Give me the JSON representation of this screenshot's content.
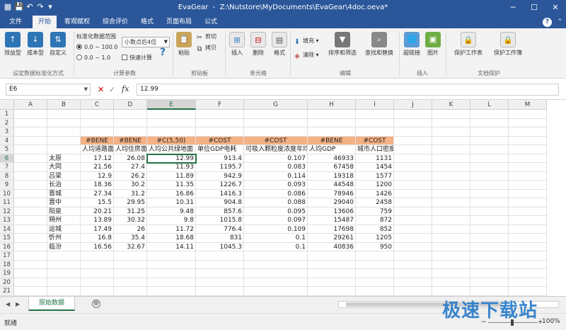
{
  "window": {
    "title": "EvaGear  -  Z:\\Nutstore\\MyDocuments\\EvaGear\\4doc.oeva*",
    "minimize": "─",
    "maximize": "☐",
    "close": "✕"
  },
  "tabs": [
    {
      "label": "文件"
    },
    {
      "label": "开始"
    },
    {
      "label": "客观赋权"
    },
    {
      "label": "综合评价"
    },
    {
      "label": "格式"
    },
    {
      "label": "页面布局"
    },
    {
      "label": "公式"
    }
  ],
  "ribbon": {
    "standardize": {
      "buttons": [
        {
          "label": "效益型",
          "icon": "benefit-type-icon"
        },
        {
          "label": "成本型",
          "icon": "cost-type-icon"
        },
        {
          "label": "自定义",
          "icon": "custom-type-icon"
        }
      ],
      "group_label": "设定数据标准化方式"
    },
    "calc": {
      "range_label": "标准化数据范围",
      "option1": "0.0 ~ 100.0",
      "option2": "0.0 ~ 1.0",
      "decimal_value": "小数点后4位",
      "quick_calc": "快速计算",
      "group_label": "计算参数"
    },
    "clipboard": {
      "paste": "粘贴",
      "cut": "剪切",
      "copy": "拷贝",
      "group_label": "剪贴板"
    },
    "cells": {
      "insert": "插入",
      "delete": "删除",
      "format": "格式",
      "group_label": "单元格"
    },
    "edit": {
      "fill": "填充",
      "clear": "清除",
      "sort_filter": "排序和筛选",
      "find_replace": "查找和替换",
      "group_label": "编辑"
    },
    "insert": {
      "hyperlink": "超链接",
      "picture": "图片",
      "group_label": "插入"
    },
    "protect": {
      "sheet": "保护工作表",
      "book": "保护工作簿",
      "group_label": "文档保护"
    }
  },
  "formula_bar": {
    "name_box": "E6",
    "value": "12.99"
  },
  "columns": [
    "A",
    "B",
    "C",
    "D",
    "E",
    "F",
    "G",
    "H",
    "I",
    "J",
    "K",
    "L",
    "M"
  ],
  "rows": [
    "1",
    "2",
    "3",
    "4",
    "5",
    "6",
    "7",
    "8",
    "9",
    "10",
    "11",
    "12",
    "13",
    "14",
    "15",
    "16",
    "17",
    "18",
    "19",
    "20",
    "21"
  ],
  "table": {
    "header_tags": [
      "#BENE",
      "#BENE",
      "#C(5,50)",
      "#COST",
      "#COST",
      "#BENE",
      "#COST"
    ],
    "header_names": [
      "人均道路面",
      "人均住房面",
      "人均公共绿地面",
      "单位GDP电耗",
      "可吸入颗粒度浓度年均",
      "人均GDP",
      "城市人口密度"
    ],
    "rows": [
      {
        "city": "太原",
        "v": [
          "17.12",
          "26.08",
          "12.99",
          "913.4",
          "0.107",
          "46933",
          "1131"
        ]
      },
      {
        "city": "大同",
        "v": [
          "21.56",
          "27.4",
          "11.93",
          "1195.7",
          "0.083",
          "67458",
          "1454"
        ]
      },
      {
        "city": "吕梁",
        "v": [
          "12.9",
          "26.2",
          "11.89",
          "942.9",
          "0.114",
          "19318",
          "1577"
        ]
      },
      {
        "city": "长治",
        "v": [
          "18.36",
          "30.2",
          "11.35",
          "1226.7",
          "0.093",
          "44548",
          "1200"
        ]
      },
      {
        "city": "晋城",
        "v": [
          "27.34",
          "31.2",
          "16.86",
          "1416.3",
          "0.086",
          "78946",
          "1426"
        ]
      },
      {
        "city": "晋中",
        "v": [
          "15.5",
          "29.95",
          "10.31",
          "904.8",
          "0.088",
          "29040",
          "2458"
        ]
      },
      {
        "city": "阳泉",
        "v": [
          "20.21",
          "31.25",
          "9.48",
          "857.6",
          "0.095",
          "13606",
          "759"
        ]
      },
      {
        "city": "朔州",
        "v": [
          "13.89",
          "30.32",
          "9.8",
          "1015.8",
          "0.097",
          "15487",
          "872"
        ]
      },
      {
        "city": "运城",
        "v": [
          "17.49",
          "26",
          "11.72",
          "776.4",
          "0.109",
          "17698",
          "852"
        ]
      },
      {
        "city": "忻州",
        "v": [
          "16.8",
          "35.4",
          "18.68",
          "831",
          "0.1",
          "29261",
          "1205"
        ]
      },
      {
        "city": "临汾",
        "v": [
          "16.56",
          "32.67",
          "14.11",
          "1045.3",
          "0.1",
          "40836",
          "950"
        ]
      }
    ]
  },
  "sheets": [
    {
      "name": "原始数据"
    }
  ],
  "add_sheet": "⊕",
  "status": {
    "text": "就绪",
    "zoom_minus": "−",
    "zoom_plus": "+",
    "zoom": "100%"
  },
  "watermark": "极速下载站",
  "colors": {
    "titlebar": "#2b579a",
    "header_fill": "#f4b183",
    "selection": "#217346"
  }
}
